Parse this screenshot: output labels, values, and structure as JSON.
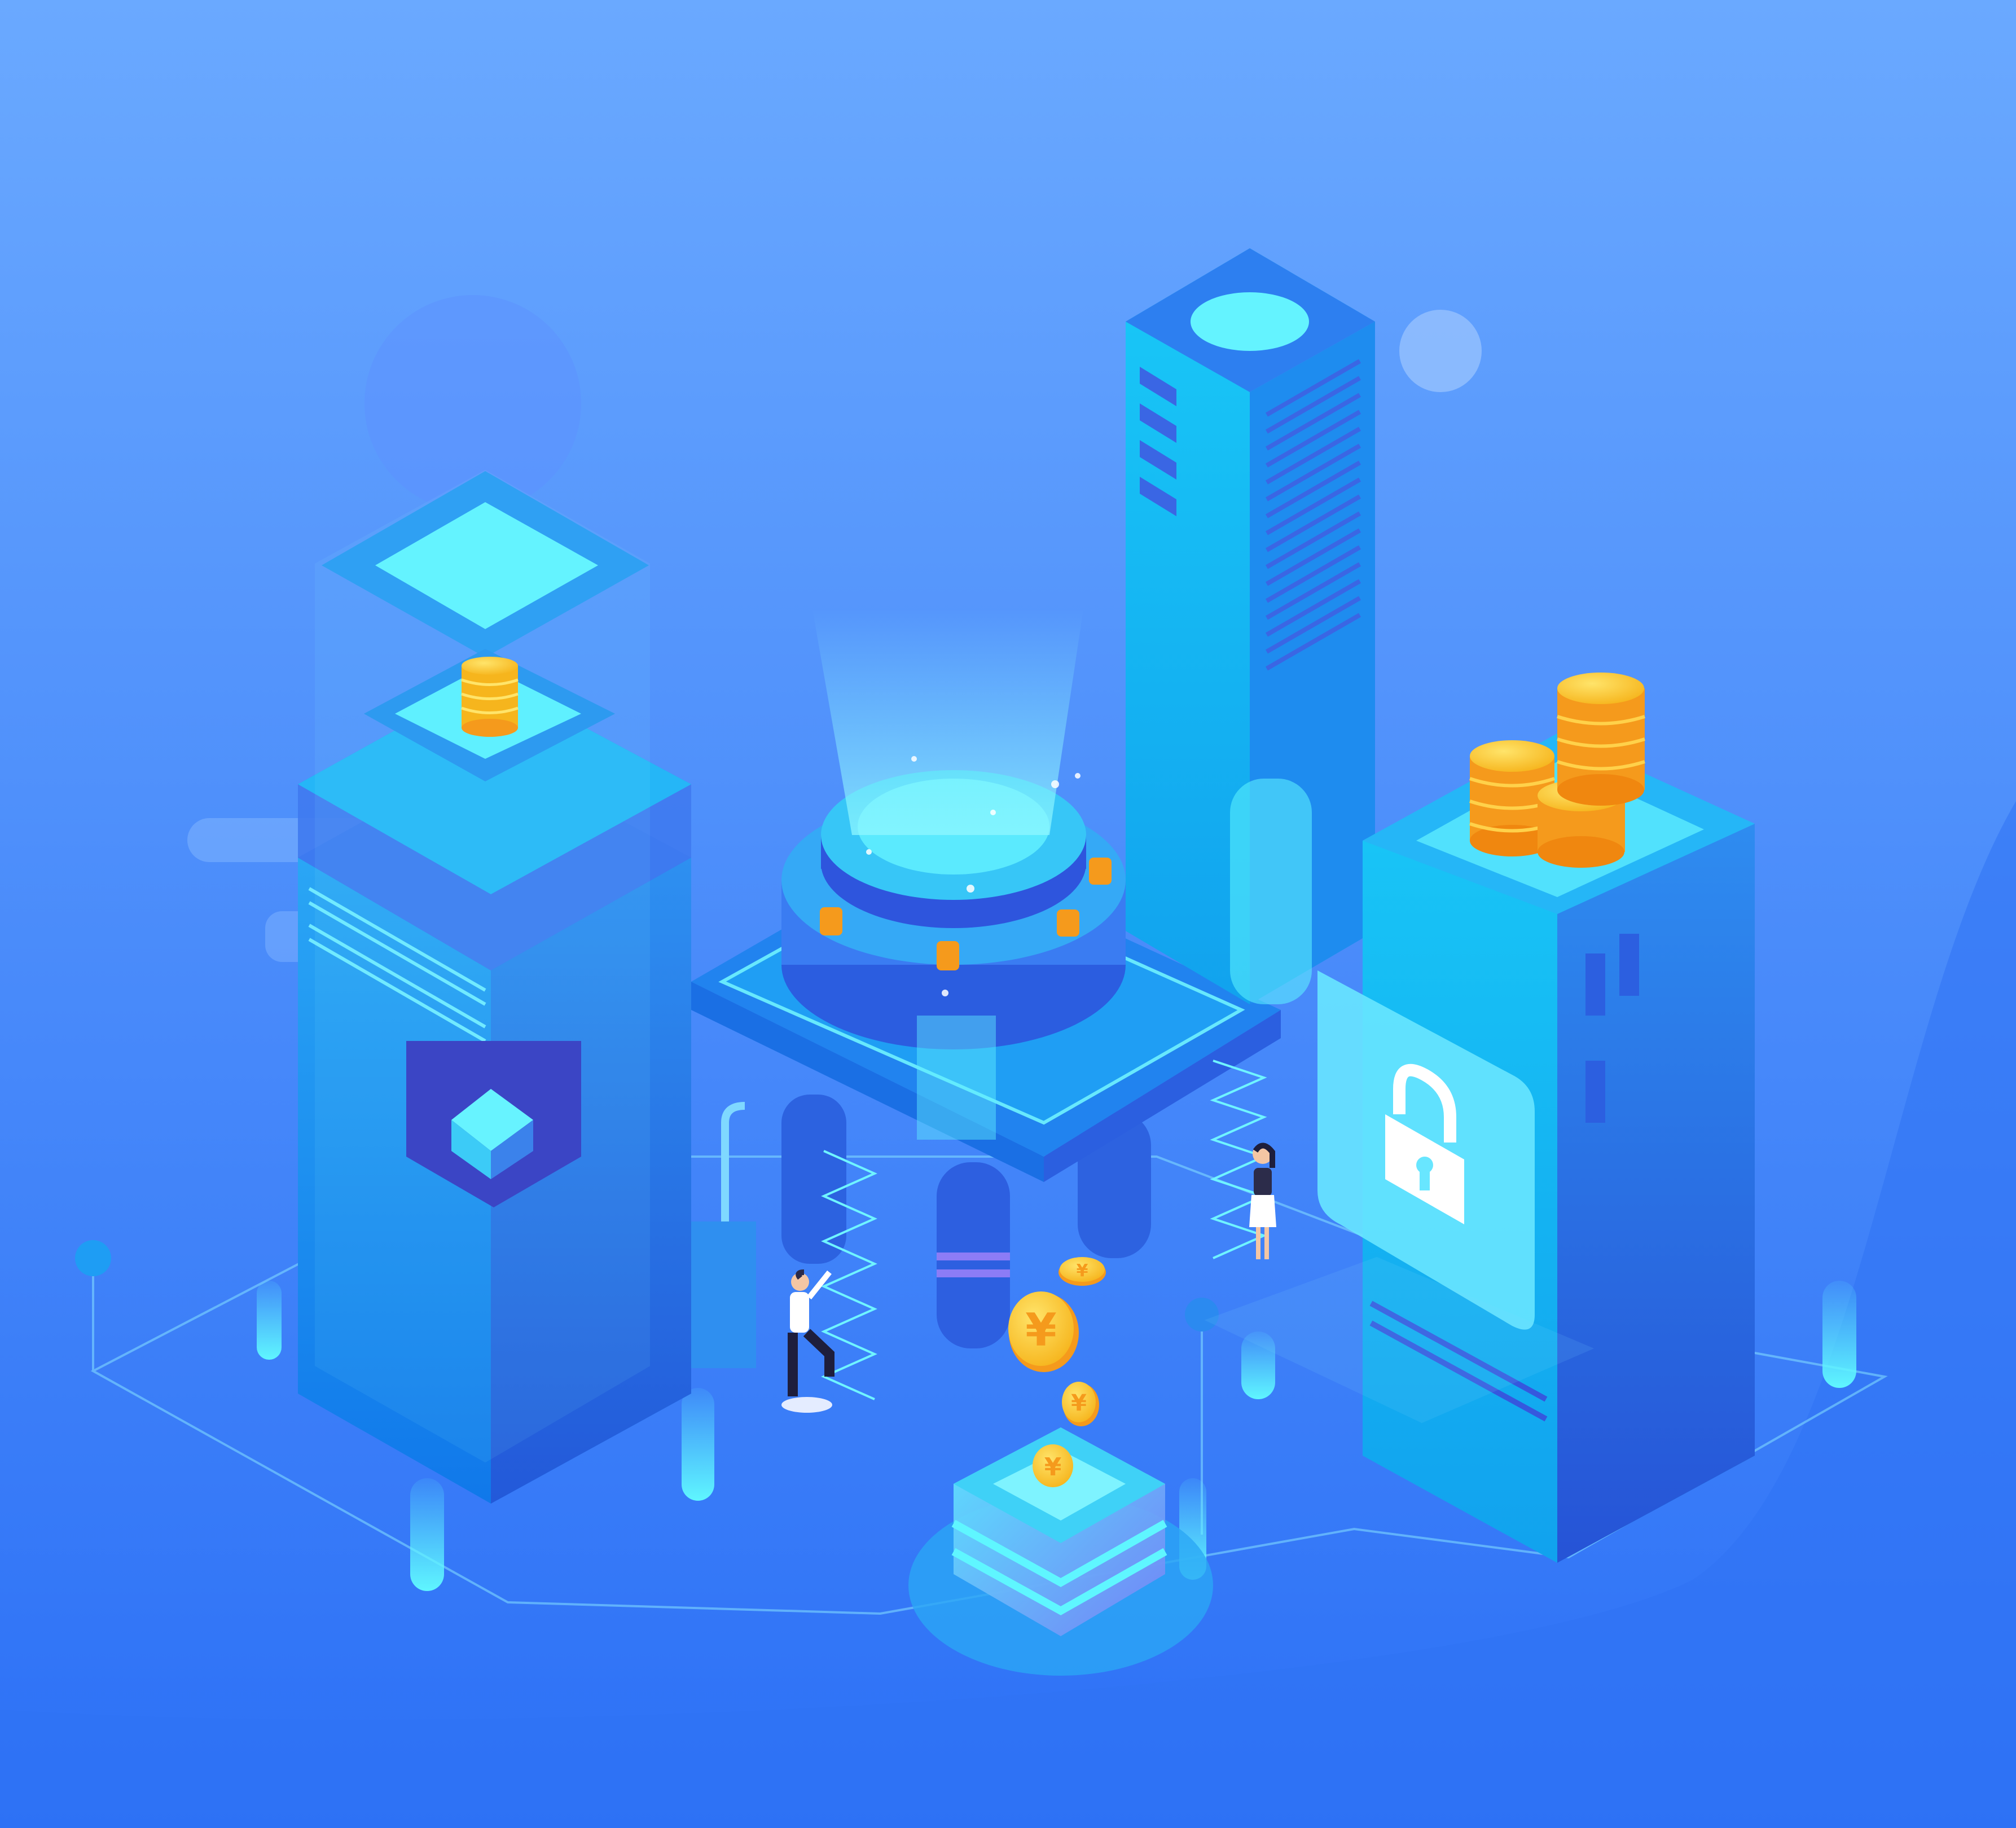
{
  "palette": {
    "background_top": "#6aa9ff",
    "background_bottom": "#2c70f6",
    "cyan_glow": "#5ff6ff",
    "tower_blue": "#1c8ef0",
    "tower_dark": "#2f5fe0",
    "coin_gold": "#ffc83a",
    "coin_orange": "#f59a1c",
    "lock_panel": "#68e6ff"
  },
  "icons": {
    "lock": "padlock-icon",
    "currency": "yen-coin-icon"
  },
  "coin_symbol": "¥"
}
